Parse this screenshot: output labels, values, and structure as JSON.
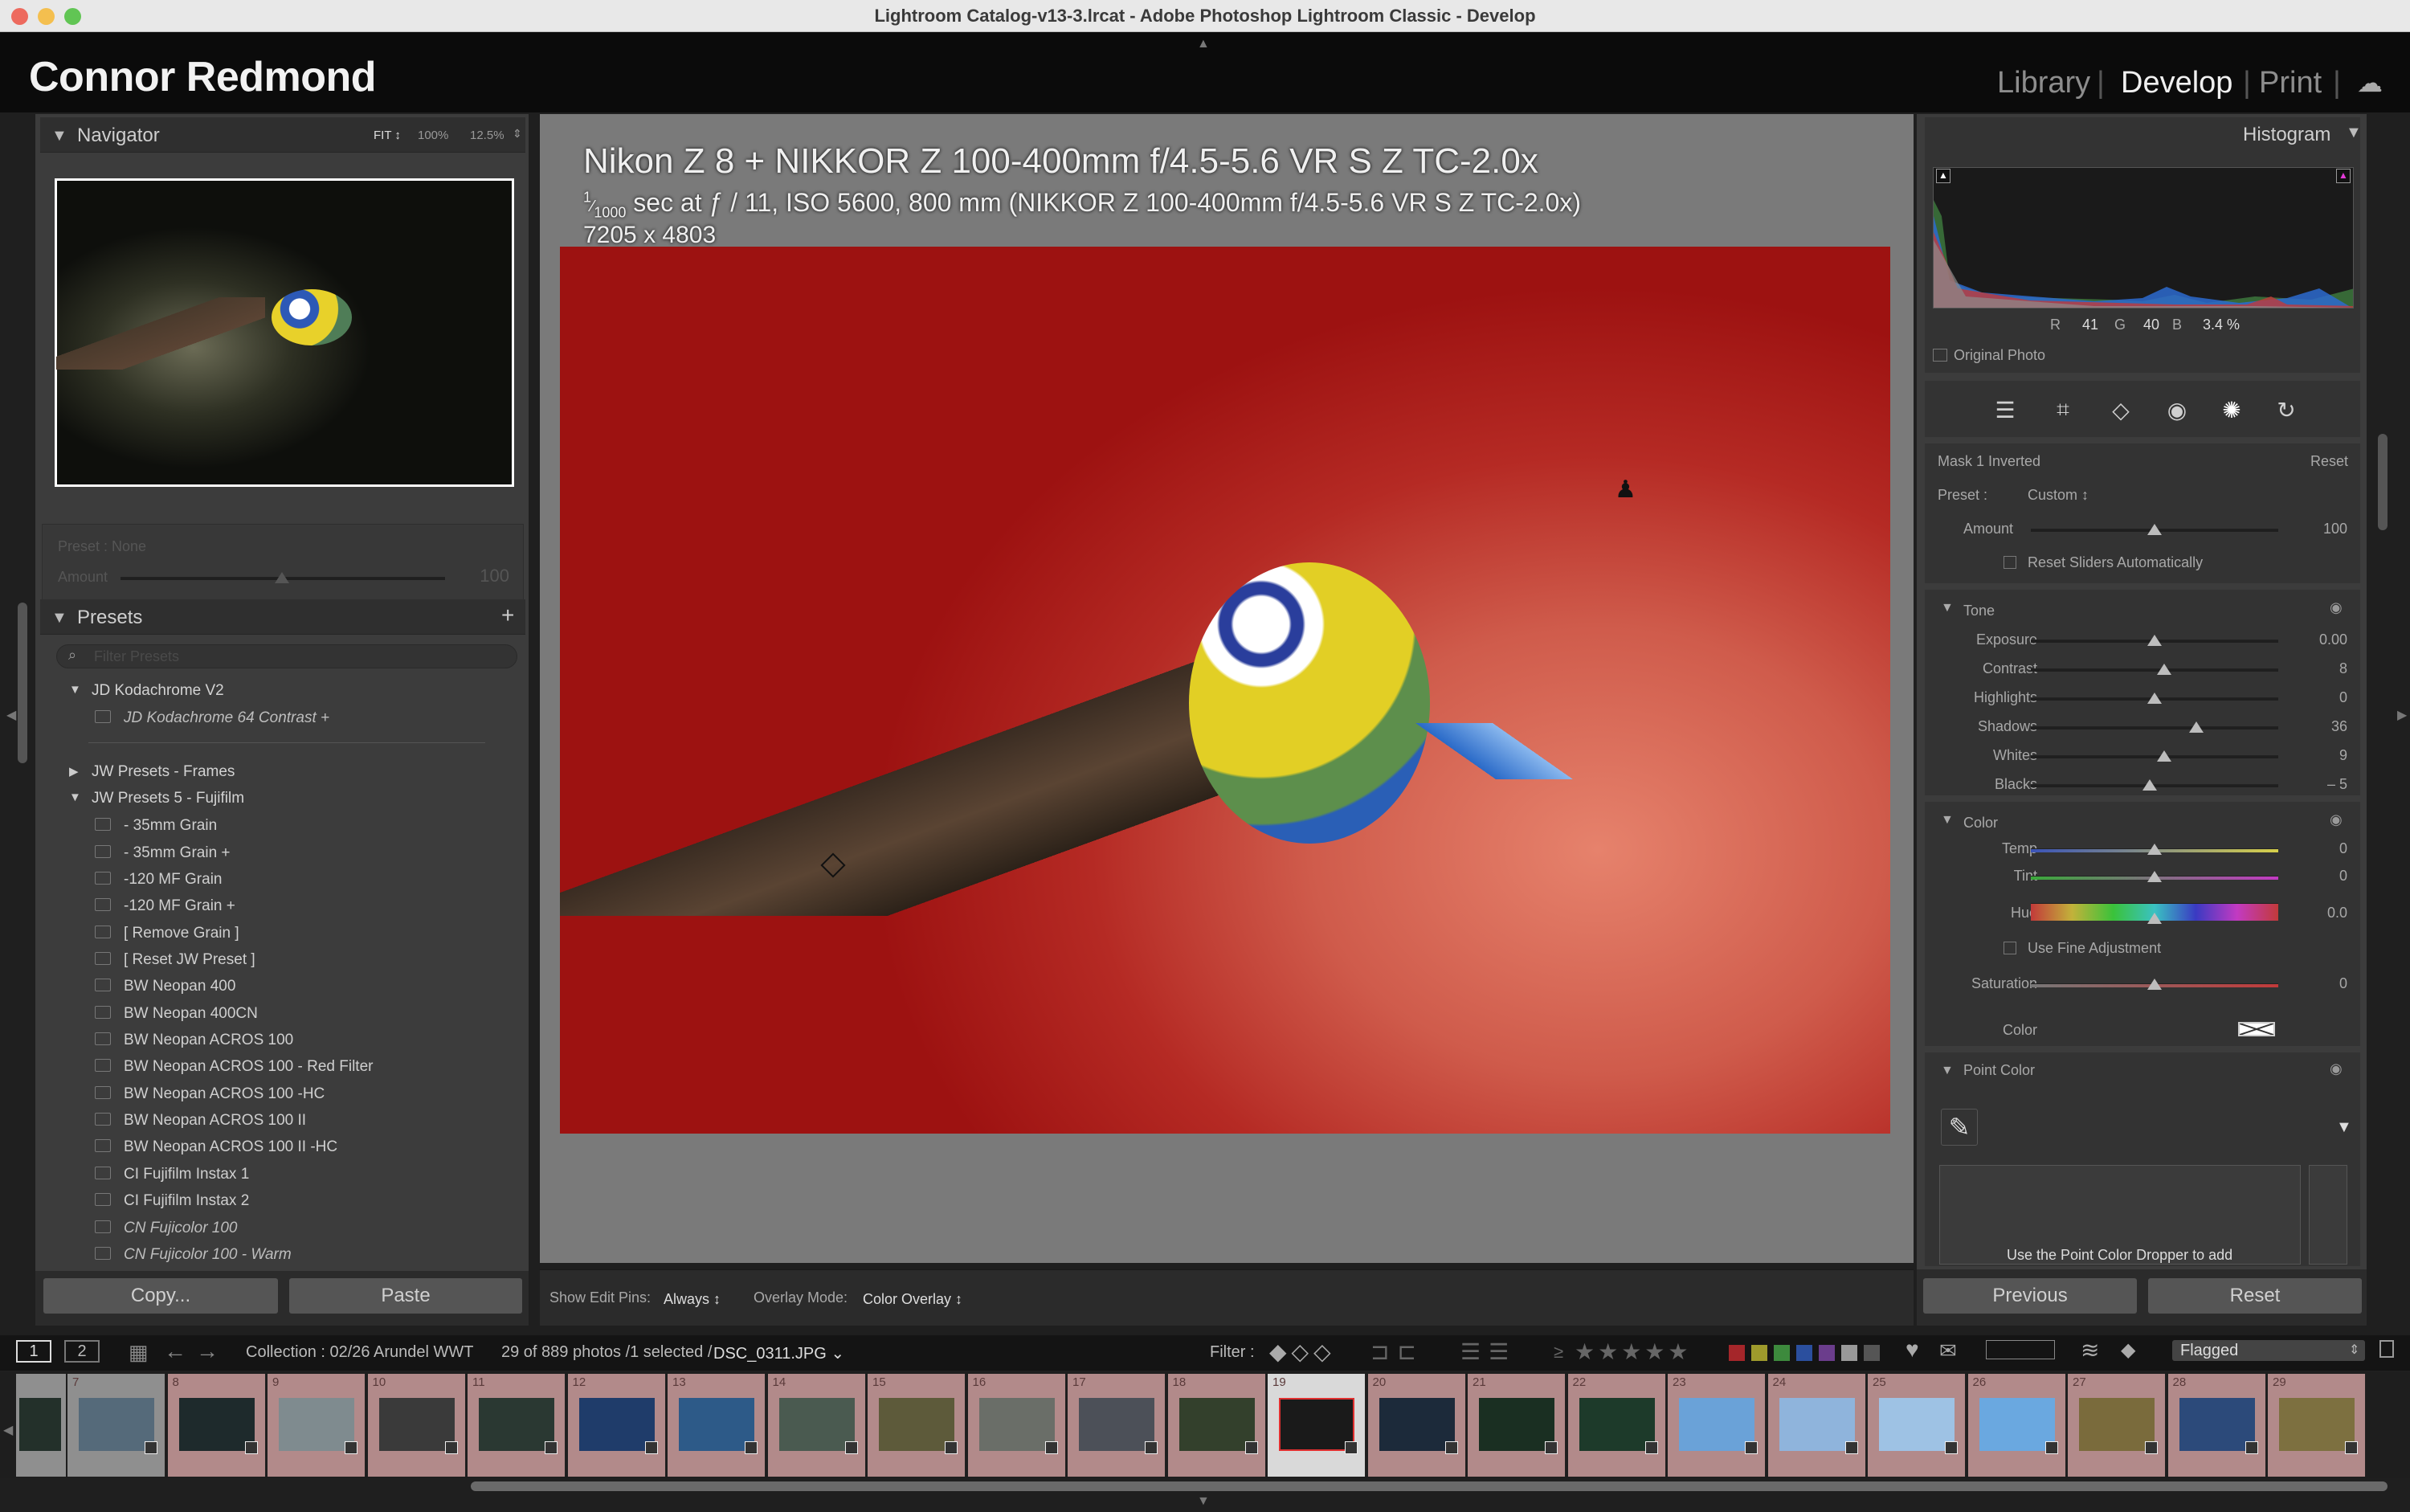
{
  "window": {
    "title": "Lightroom Catalog-v13-3.lrcat - Adobe Photoshop Lightroom Classic - Develop"
  },
  "identity_plate": "Connor Redmond",
  "modules": [
    "Library",
    "Develop",
    "Print"
  ],
  "active_module": "Develop",
  "navigator": {
    "title": "Navigator",
    "zoom_fit": "FIT ↕",
    "zoom_100": "100%",
    "zoom_125": "12.5%"
  },
  "quick_preset": {
    "preset_label": "Preset : None",
    "amount_label": "Amount",
    "amount_value": "100"
  },
  "presets": {
    "title": "Presets",
    "filter_placeholder": "Filter Presets",
    "groups": [
      {
        "name": "JD Kodachrome V2",
        "items": [
          "JD Kodachrome 64 Contrast +"
        ]
      },
      {
        "name": "JW Presets - Frames",
        "items": []
      },
      {
        "name": "JW Presets 5 - Fujifilm",
        "items": [
          "- 35mm Grain",
          "- 35mm Grain +",
          "-120 MF Grain",
          "-120 MF Grain +",
          "[ Remove Grain ]",
          "[ Reset JW Preset ]",
          "BW Neopan 400",
          "BW Neopan 400CN",
          "BW Neopan ACROS 100",
          "BW Neopan ACROS 100 - Red Filter",
          "BW Neopan ACROS 100 -HC",
          "BW Neopan ACROS 100 II",
          "BW Neopan ACROS 100 II -HC",
          "CI Fujifilm Instax 1",
          "CI Fujifilm Instax 2",
          "CN Fujicolor 100",
          "CN Fujicolor 100 - Warm"
        ]
      }
    ]
  },
  "left_buttons": {
    "copy": "Copy...",
    "paste": "Paste"
  },
  "photo_info": {
    "line1": "Nikon Z 8 + NIKKOR Z 100-400mm f/4.5-5.6 VR S Z TC-2.0x",
    "shutter_num": "1",
    "shutter_den": "1000",
    "line2_rest": " sec at ƒ / 11, ISO 5600, 800 mm (NIKKOR Z 100-400mm f/4.5-5.6 VR S Z TC-2.0x)",
    "line3": "7205 x 4803"
  },
  "toolbar": {
    "show_pins_label": "Show Edit Pins:",
    "show_pins_value": "Always ↕",
    "overlay_label": "Overlay Mode:",
    "overlay_value": "Color Overlay ↕"
  },
  "histogram": {
    "title": "Histogram",
    "r_label": "R",
    "r_value": "41",
    "g_label": "G",
    "g_value": "40",
    "b_label": "B",
    "b_value": "3.4 %",
    "original_photo": "Original Photo"
  },
  "mask": {
    "title": "Mask 1 Inverted",
    "reset": "Reset",
    "preset_label": "Preset :",
    "preset_value": "Custom ↕",
    "amount_label": "Amount",
    "amount_value": "100",
    "reset_sliders": "Reset Sliders Automatically"
  },
  "tone": {
    "title": "Tone",
    "sliders": [
      {
        "label": "Exposure",
        "value": "0.00",
        "pos": 0.5
      },
      {
        "label": "Contrast",
        "value": "8",
        "pos": 0.54
      },
      {
        "label": "Highlights",
        "value": "0",
        "pos": 0.5
      },
      {
        "label": "Shadows",
        "value": "36",
        "pos": 0.67
      },
      {
        "label": "Whites",
        "value": "9",
        "pos": 0.54
      },
      {
        "label": "Blacks",
        "value": "– 5",
        "pos": 0.48
      }
    ]
  },
  "color": {
    "title": "Color",
    "temp_label": "Temp",
    "temp_value": "0",
    "tint_label": "Tint",
    "tint_value": "0",
    "hue_label": "Hue",
    "hue_value": "0.0",
    "fine_adjust": "Use Fine Adjustment",
    "saturation_label": "Saturation",
    "saturation_value": "0",
    "color_label": "Color"
  },
  "point_color": {
    "title": "Point Color",
    "hint": "Use the Point Color Dropper to add"
  },
  "right_buttons": {
    "previous": "Previous",
    "reset": "Reset"
  },
  "filmstrip_bar": {
    "view1": "1",
    "view2": "2",
    "collection": "Collection : 02/26 Arundel WWT",
    "count": "29 of 889 photos /1 selected /",
    "filename": "DSC_0311.JPG ⌄",
    "filter_label": "Filter :",
    "rating_op": "≥",
    "flag_filter": "Flagged"
  },
  "filmstrip_numbers": [
    "7",
    "8",
    "9",
    "10",
    "11",
    "12",
    "13",
    "14",
    "15",
    "16",
    "17",
    "18",
    "19",
    "20",
    "21",
    "22",
    "23",
    "24",
    "25",
    "26",
    "27",
    "28",
    "29"
  ],
  "colors": {
    "accent": "#ffffff",
    "panel": "#3c3c3c",
    "label_red": "#a5262a",
    "label_yellow": "#9e9a2c",
    "label_green": "#3d8a3d",
    "label_blue": "#2b4f9e",
    "label_purple": "#6b3d8c"
  }
}
